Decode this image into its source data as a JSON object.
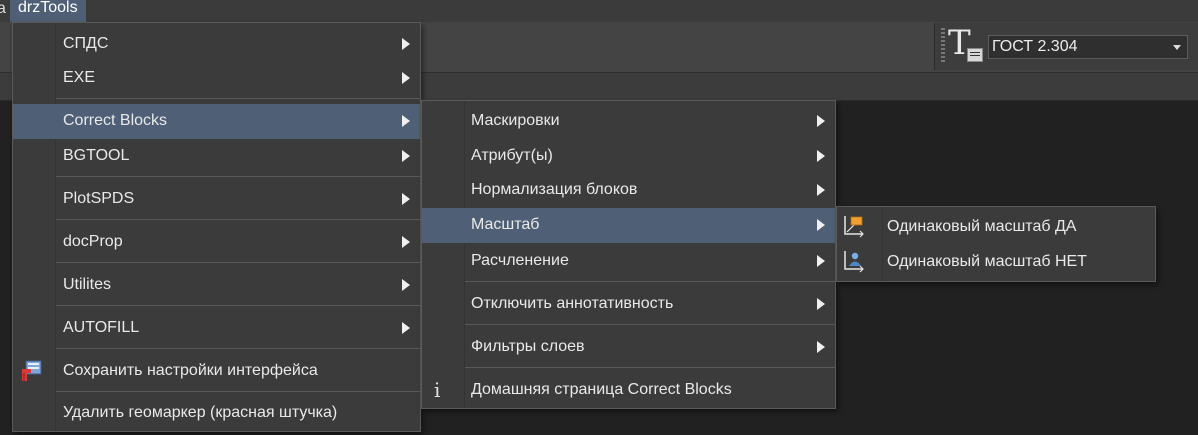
{
  "menubar": {
    "prev_fragment": "a",
    "active_menu": "drzTools"
  },
  "toolbar": {
    "text_style_icon": "text-style-icon",
    "text_style_value": "ГОСТ 2.304"
  },
  "main_menu": {
    "items": [
      {
        "label": "СПДС",
        "submenu": true
      },
      {
        "label": "EXE",
        "submenu": true
      },
      {
        "label": "Correct Blocks",
        "submenu": true,
        "highlighted": true
      },
      {
        "label": "BGTOOL",
        "submenu": true
      },
      {
        "label": "PlotSPDS",
        "submenu": true
      },
      {
        "label": "docProp",
        "submenu": true
      },
      {
        "label": "Utilites",
        "submenu": true
      },
      {
        "label": "AUTOFILL",
        "submenu": true
      },
      {
        "label": "Сохранить настройки интерфейса",
        "submenu": false,
        "icon": "save-settings-icon"
      },
      {
        "label": "Удалить геомаркер (красная штучка)",
        "submenu": false
      }
    ]
  },
  "correct_blocks_menu": {
    "items": [
      {
        "label": "Маскировки",
        "submenu": true
      },
      {
        "label": "Атрибут(ы)",
        "submenu": true
      },
      {
        "label": "Нормализация блоков",
        "submenu": true
      },
      {
        "label": "Масштаб",
        "submenu": true,
        "highlighted": true
      },
      {
        "label": "Расчленение",
        "submenu": true
      },
      {
        "label": "Отключить аннотативность",
        "submenu": true
      },
      {
        "label": "Фильтры слоев",
        "submenu": true
      },
      {
        "label": "Домашняя страница Correct Blocks",
        "submenu": false,
        "icon": "info-icon",
        "icon_glyph": "i"
      }
    ]
  },
  "scale_menu": {
    "items": [
      {
        "label": "Одинаковый масштаб ДА",
        "icon": "scale-yes-icon"
      },
      {
        "label": "Одинаковый масштаб НЕТ",
        "icon": "scale-no-icon"
      }
    ]
  },
  "colors": {
    "highlight": "#4f5f75",
    "menu_bg": "#3b3b3b",
    "canvas_bg": "#212121"
  }
}
